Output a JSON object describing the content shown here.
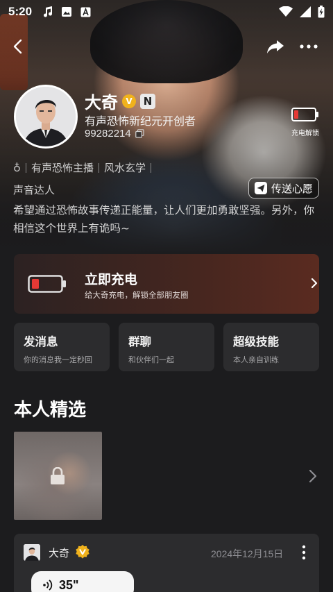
{
  "status_bar": {
    "time": "5:20",
    "icons_left": [
      "music-note-icon",
      "image-icon",
      "translate-a-icon"
    ],
    "icons_right": [
      "wifi-icon",
      "signal-icon",
      "battery-charging-icon"
    ]
  },
  "nav": {
    "icons": [
      "back-arrow-icon",
      "share-icon",
      "more-icon"
    ]
  },
  "profile": {
    "name": "大奇",
    "v_badge": "V",
    "n_badge": "N",
    "subtitle": "有声恐怖新纪元开创者",
    "uid": "99282214",
    "gender_symbol": "♁",
    "tags": [
      "有声恐怖主播",
      "风水玄学"
    ],
    "role": "声音达人",
    "bio": "希望通过恐怖故事传递正能量，让人们更加勇敢坚强。另外，你相信这个世界上有诡吗~",
    "wish_button": "传送心愿",
    "charge_unlock_label": "充电解锁"
  },
  "recharge": {
    "title": "立即充电",
    "subtitle": "给大奇充电，解锁全部朋友圈"
  },
  "quick_actions": [
    {
      "title": "发消息",
      "subtitle": "你的消息我一定秒回"
    },
    {
      "title": "群聊",
      "subtitle": "和伙伴们一起"
    },
    {
      "title": "超级技能",
      "subtitle": "本人亲自训练"
    }
  ],
  "featured": {
    "title": "本人精选"
  },
  "moment": {
    "name": "大奇",
    "date": "2024年12月15日",
    "voice_duration": "35\""
  },
  "colors": {
    "background": "#1c1c1e",
    "card": "#2c2c2e",
    "battery_red": "#e53935",
    "vip_gold": "#f0b21c"
  }
}
